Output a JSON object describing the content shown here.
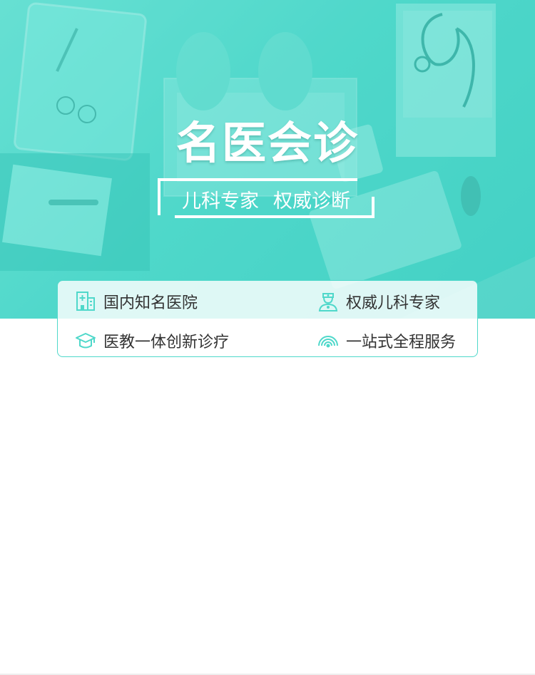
{
  "hero": {
    "title": "名医会诊",
    "subtitle_left": "儿科专家",
    "subtitle_right": "权威诊断"
  },
  "features": [
    {
      "label": "国内知名医院",
      "icon": "hospital-building-icon"
    },
    {
      "label": "权威儿科专家",
      "icon": "doctor-icon"
    },
    {
      "label": "医教一体创新诊疗",
      "icon": "graduation-cap-icon"
    },
    {
      "label": "一站式全程服务",
      "icon": "signal-waves-icon"
    }
  ],
  "colors": {
    "accent": "#4fd8ca",
    "hero_start": "#6fe3d6",
    "hero_end": "#3fcfc2",
    "text": "#333333"
  }
}
